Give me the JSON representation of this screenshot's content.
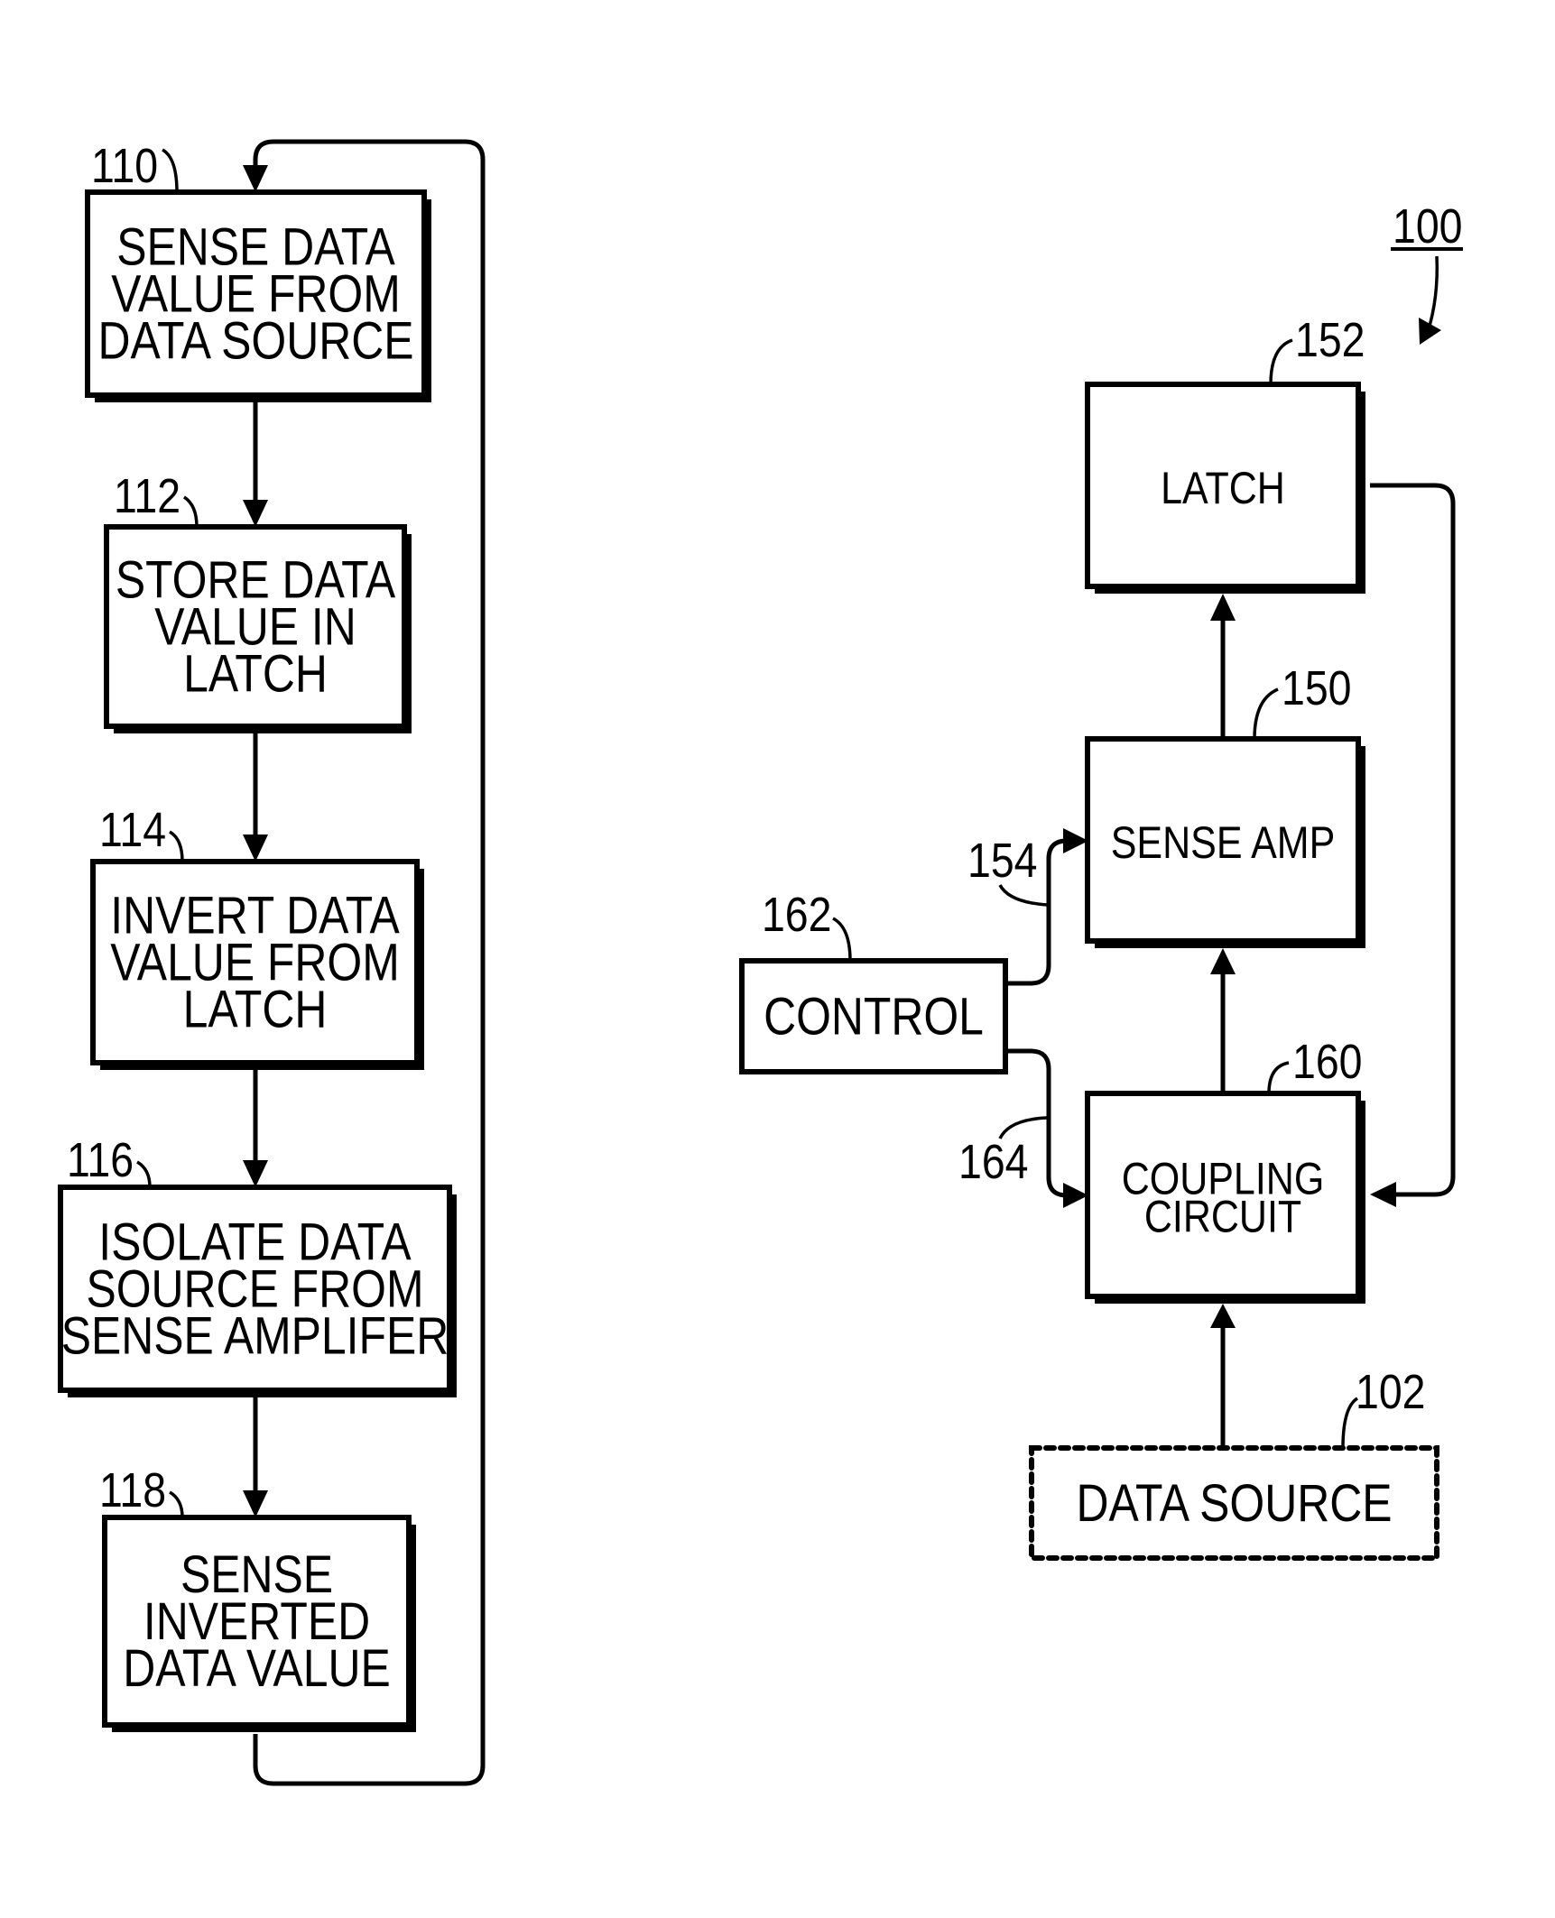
{
  "figure": {
    "figure_number": "100",
    "flowchart": {
      "steps": [
        {
          "ref": "110",
          "lines": [
            "SENSE  DATA",
            "VALUE FROM",
            "DATA SOURCE"
          ]
        },
        {
          "ref": "112",
          "lines": [
            "STORE DATA",
            "VALUE IN",
            "LATCH"
          ]
        },
        {
          "ref": "114",
          "lines": [
            "INVERT DATA",
            "VALUE FROM",
            "LATCH"
          ]
        },
        {
          "ref": "116",
          "lines": [
            "ISOLATE DATA",
            "SOURCE FROM",
            "SENSE AMPLIFER"
          ]
        },
        {
          "ref": "118",
          "lines": [
            "SENSE",
            "INVERTED",
            "DATA VALUE"
          ]
        }
      ],
      "loops_back_to": "110"
    },
    "block_diagram": {
      "blocks": {
        "latch": {
          "ref": "152",
          "lines": [
            "LATCH"
          ]
        },
        "sense_amp": {
          "ref": "150",
          "lines": [
            "SENSE AMP"
          ]
        },
        "coupling": {
          "ref": "160",
          "lines": [
            "COUPLING",
            "CIRCUIT"
          ]
        },
        "control": {
          "ref": "162",
          "lines": [
            "CONTROL"
          ]
        },
        "data_source": {
          "ref": "102",
          "lines": [
            "DATA SOURCE"
          ],
          "style": "dashed"
        }
      },
      "signals": {
        "control_to_sense_amp": "154",
        "control_to_coupling": "164"
      },
      "connections": [
        {
          "from": "data_source",
          "to": "coupling"
        },
        {
          "from": "coupling",
          "to": "sense_amp"
        },
        {
          "from": "sense_amp",
          "to": "latch"
        },
        {
          "from": "latch",
          "to": "coupling"
        },
        {
          "from": "control",
          "to": "sense_amp",
          "signal": "154"
        },
        {
          "from": "control",
          "to": "coupling",
          "signal": "164"
        }
      ]
    }
  }
}
